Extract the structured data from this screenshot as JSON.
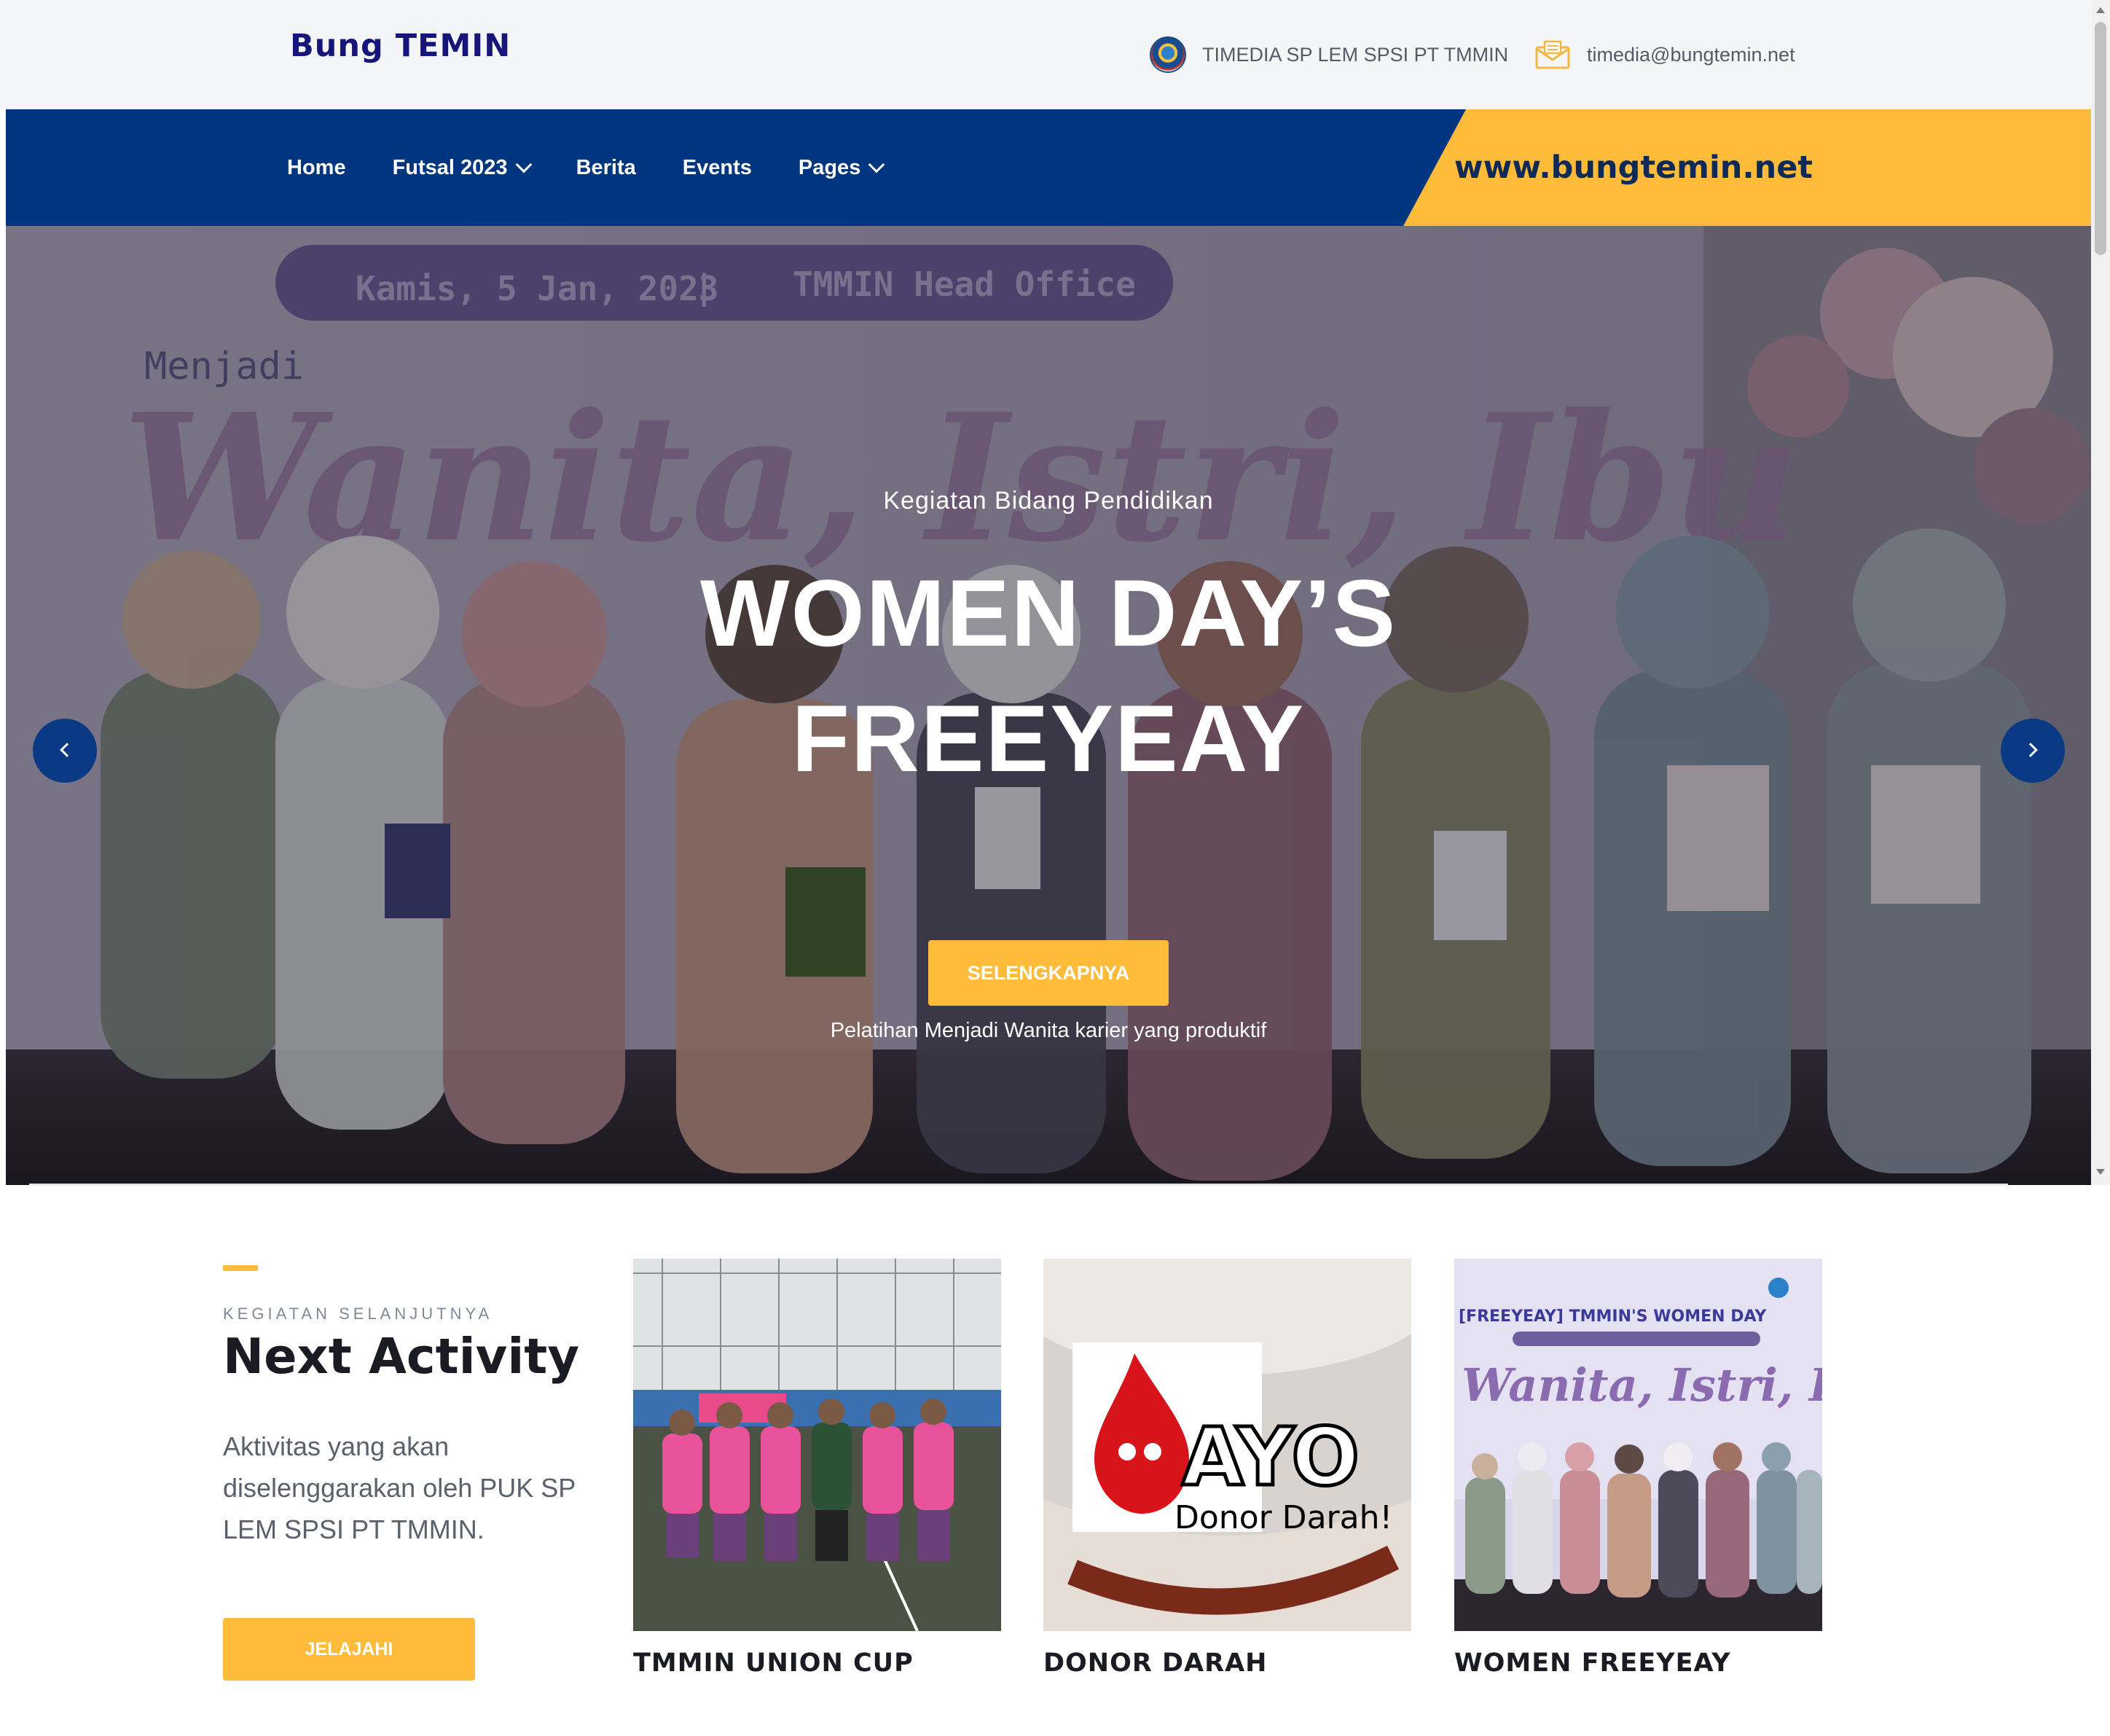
{
  "header": {
    "brand": "Bung TEMIN",
    "org_text": "TIMEDIA SP LEM SPSI PT TMMIN",
    "email": "timedia@bungtemin.net"
  },
  "nav": {
    "items": [
      {
        "label": "Home",
        "dropdown": false
      },
      {
        "label": "Futsal 2023",
        "dropdown": true
      },
      {
        "label": "Berita",
        "dropdown": false
      },
      {
        "label": "Events",
        "dropdown": false
      },
      {
        "label": "Pages",
        "dropdown": true
      }
    ],
    "url_badge": "www.bungtemin.net"
  },
  "hero": {
    "subtitle": "Kegiatan Bidang Pendidikan",
    "title_line1": "WOMEN DAY’S",
    "title_line2": "FREEYEAY",
    "description": "Pelatihan Menjadi Wanita karier yang produktif",
    "button": "SELENGKAPNYA",
    "banner_date": "Kamis, 5 Jan, 2023",
    "banner_place": "TMMIN Head Office",
    "banner_script": "Wanita, Istri, Ibu",
    "banner_pre": "Menjadi"
  },
  "activity": {
    "kicker": "KEGIATAN SELANJUTNYA",
    "title": "Next Activity",
    "description": "Aktivitas yang akan diselenggarakan oleh PUK SP LEM SPSI PT TMMIN.",
    "button": "JELAJAHI",
    "cards": [
      {
        "caption": "TMMIN UNION CUP"
      },
      {
        "caption": "DONOR DARAH",
        "overlay_big": "AYO",
        "overlay_small": "Donor Darah!"
      },
      {
        "caption": "WOMEN FREEYEAY",
        "overlay_title": "[FREEYEAY] TMMIN'S WOMEN DAY",
        "overlay_script": "Wanita, Istri, Ibu"
      }
    ]
  },
  "colors": {
    "navy": "#003580",
    "accent": "#ffbb3a",
    "brand_text": "#16157a"
  },
  "icons": {
    "org": "org-logo-icon",
    "mail": "envelope-icon",
    "prev": "chevron-left-icon",
    "next": "chevron-right-icon"
  }
}
